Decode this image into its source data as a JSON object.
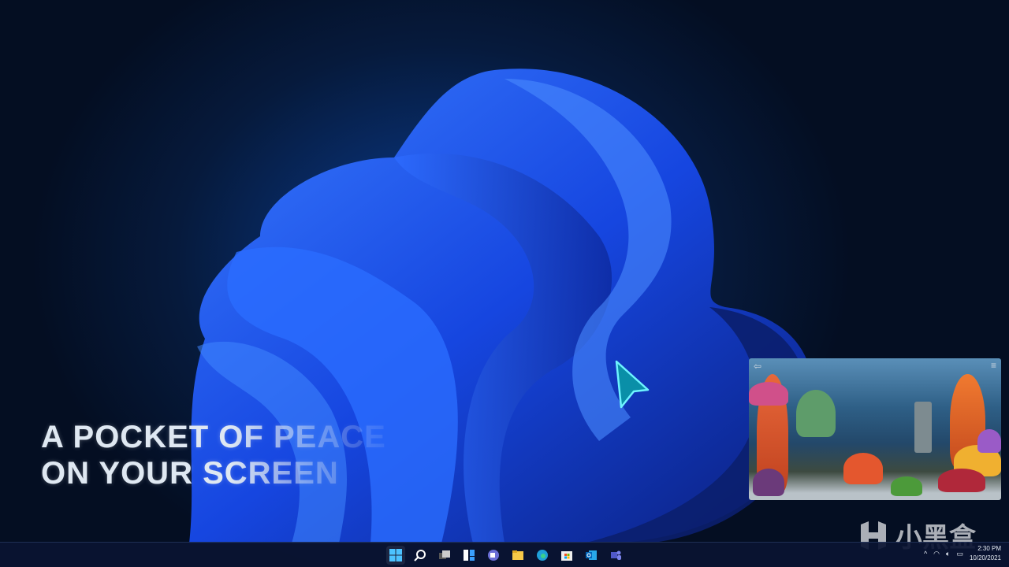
{
  "caption": {
    "line1": "A POCKET OF PEACE",
    "line2": "ON YOUR SCREEN"
  },
  "aquarium_widget": {
    "back_icon": "fish-back-icon",
    "menu_icon": "menu-icon"
  },
  "taskbar": {
    "icons": [
      "windows-start-icon",
      "search-icon",
      "task-view-icon",
      "widgets-icon",
      "teams-chat-icon",
      "file-explorer-icon",
      "edge-icon",
      "microsoft-store-icon",
      "outlook-icon",
      "teams-icon"
    ]
  },
  "tray": {
    "time": "2:30 PM",
    "date": "10/20/2021",
    "chevron": "^"
  },
  "watermark": {
    "text": "小黑盒"
  },
  "colors": {
    "accent": "#1f5fff",
    "background": "#061a3c"
  }
}
